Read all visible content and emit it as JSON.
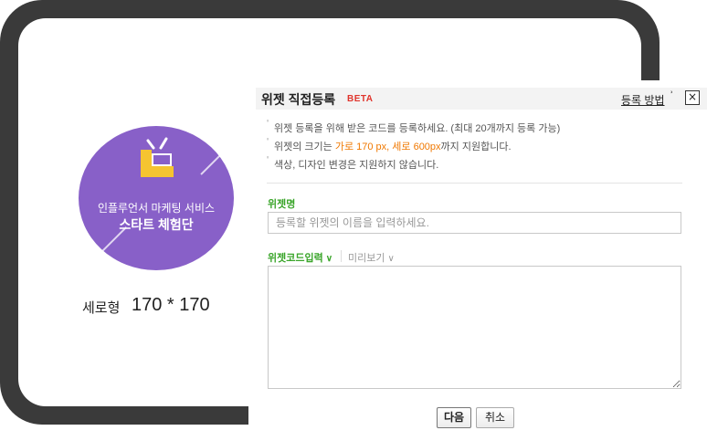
{
  "preview": {
    "widget_line1": "인플루언서 마케팅 서비스",
    "widget_line2": "스타트 체험단",
    "size_label": "세로형",
    "size_value": "170 * 170",
    "circle_color": "#8860c8"
  },
  "dialog": {
    "title": "위젯 직접등록",
    "badge": "BETA",
    "help_link": "등록 방법",
    "help_mark": "ʾ",
    "close_icon": "×",
    "notes": [
      {
        "text": "위젯 등록을 위해 받은 코드를 등록하세요. (최대 20개까지 등록 가능)"
      },
      {
        "pre": "위젯의 크기는 ",
        "highlight": "가로 170 px, 세로 600px",
        "post": "까지 지원합니다."
      },
      {
        "text": "색상, 디자인 변경은 지원하지 않습니다."
      }
    ],
    "name_label": "위젯명",
    "name_placeholder": "등록할 위젯의 이름을 입력하세요.",
    "tab_code": "위젯코드입력",
    "tab_preview": "미리보기",
    "chevron": "∨",
    "next_button": "다음",
    "cancel_button": "취소",
    "accent_green": "#3aa52a",
    "accent_orange": "#f07800",
    "beta_red": "#e0342c"
  }
}
